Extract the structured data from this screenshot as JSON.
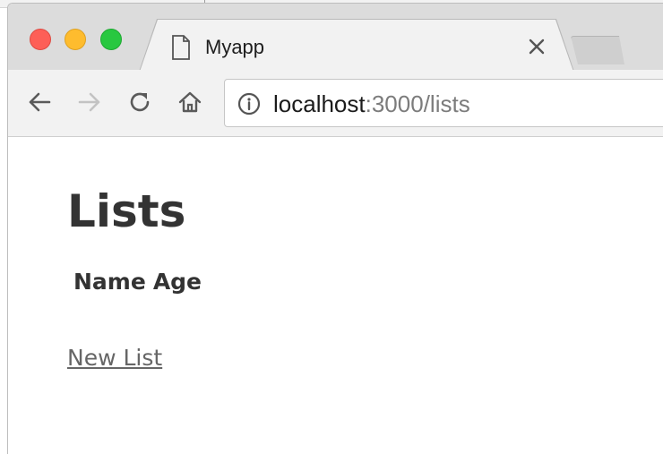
{
  "browser": {
    "tab": {
      "title": "Myapp"
    },
    "address": {
      "host": "localhost",
      "path": ":3000/lists"
    }
  },
  "page": {
    "heading": "Lists",
    "table": {
      "columns": [
        "Name",
        "Age"
      ]
    },
    "new_link": "New List"
  },
  "colors": {
    "traffic_red": "#fd5f57",
    "traffic_yellow": "#febc2e",
    "traffic_green": "#28c840",
    "heading": "#333333",
    "link": "#666666"
  },
  "icons": [
    "document-icon",
    "close-icon",
    "back-arrow-icon",
    "forward-arrow-icon",
    "reload-icon",
    "home-icon",
    "info-icon"
  ]
}
